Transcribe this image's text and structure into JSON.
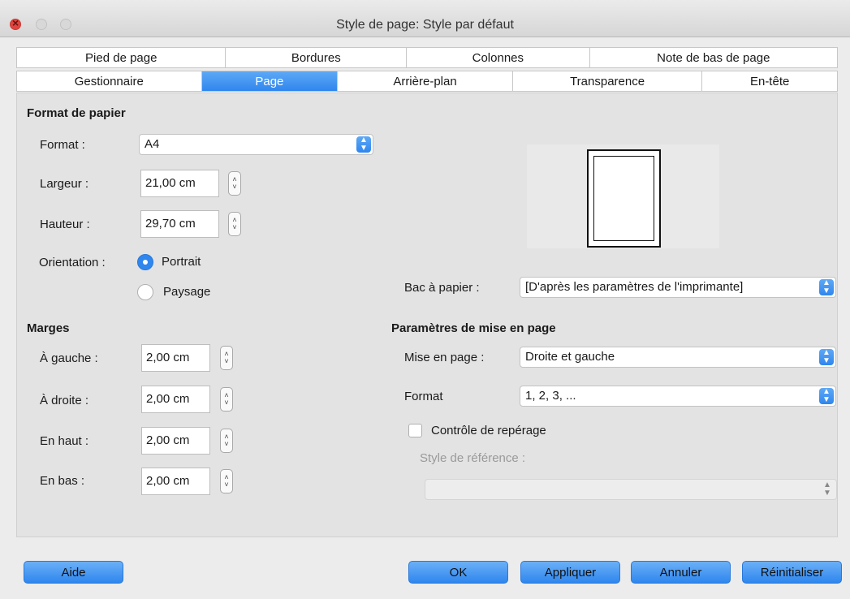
{
  "window": {
    "title": "Style de page: Style par défaut"
  },
  "tabs": {
    "row1": [
      "Pied de page",
      "Bordures",
      "Colonnes",
      "Note de bas de page"
    ],
    "row2": [
      "Gestionnaire",
      "Page",
      "Arrière-plan",
      "Transparence",
      "En-tête"
    ],
    "active": "Page"
  },
  "paper": {
    "heading": "Format de papier",
    "format_label": "Format :",
    "format_value": "A4",
    "width_label": "Largeur :",
    "width_value": "21,00 cm",
    "height_label": "Hauteur :",
    "height_value": "29,70 cm",
    "orientation_label": "Orientation :",
    "portrait_label": "Portrait",
    "landscape_label": "Paysage",
    "selected_orientation": "Portrait"
  },
  "tray": {
    "label": "Bac à papier :",
    "value": "[D'après les paramètres de l'imprimante]"
  },
  "margins": {
    "heading": "Marges",
    "left_label": "À gauche :",
    "left_value": "2,00 cm",
    "right_label": "À droite :",
    "right_value": "2,00 cm",
    "top_label": "En haut :",
    "top_value": "2,00 cm",
    "bottom_label": "En bas :",
    "bottom_value": "2,00 cm"
  },
  "layout": {
    "heading": "Paramètres de mise en page",
    "layout_label": "Mise en page :",
    "layout_value": "Droite et gauche",
    "format_label": "Format",
    "format_value": "1, 2, 3, ...",
    "register_label": "Contrôle de repérage",
    "register_checked": false,
    "reference_label": "Style de référence :",
    "reference_value": ""
  },
  "buttons": {
    "help": "Aide",
    "ok": "OK",
    "apply": "Appliquer",
    "cancel": "Annuler",
    "reset": "Réinitialiser"
  },
  "colors": {
    "accent": "#2f86ee",
    "close": "#e0443e"
  }
}
